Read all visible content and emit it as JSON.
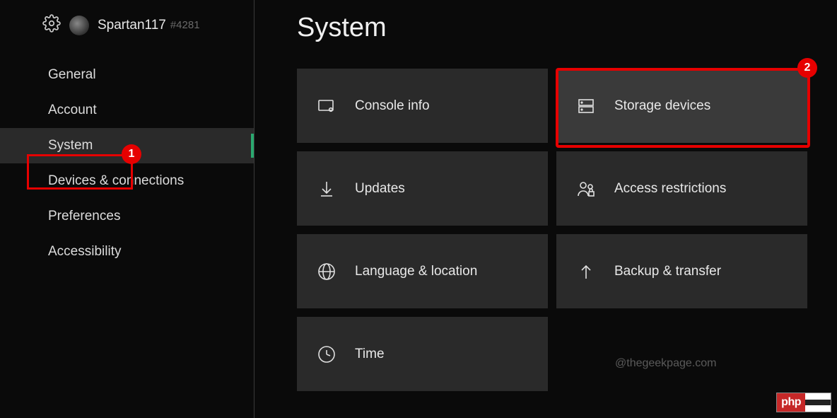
{
  "user": {
    "name": "Spartan117",
    "tag": "#4281"
  },
  "sidebar": {
    "items": [
      {
        "label": "General"
      },
      {
        "label": "Account"
      },
      {
        "label": "System",
        "active": true
      },
      {
        "label": "Devices & connections"
      },
      {
        "label": "Preferences"
      },
      {
        "label": "Accessibility"
      }
    ]
  },
  "page": {
    "title": "System"
  },
  "tiles": [
    {
      "label": "Console info",
      "icon": "console-info-icon"
    },
    {
      "label": "Storage devices",
      "icon": "storage-devices-icon",
      "highlight": true
    },
    {
      "label": "Updates",
      "icon": "updates-icon"
    },
    {
      "label": "Access restrictions",
      "icon": "access-restrictions-icon"
    },
    {
      "label": "Language & location",
      "icon": "globe-icon"
    },
    {
      "label": "Backup & transfer",
      "icon": "backup-transfer-icon"
    },
    {
      "label": "Time",
      "icon": "clock-icon"
    }
  ],
  "watermark": "@thegeekpage.com",
  "annotations": {
    "badge1": "1",
    "badge2": "2"
  },
  "footer_badge": {
    "left": "php"
  }
}
